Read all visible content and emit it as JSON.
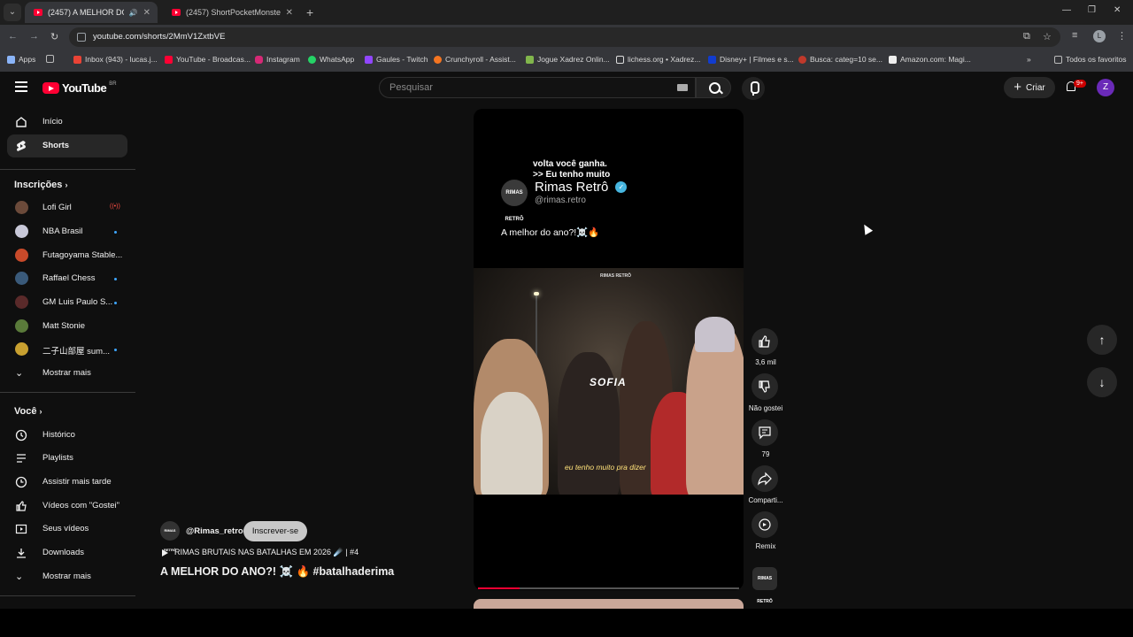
{
  "browser": {
    "tabs": [
      {
        "title": "(2457) A MELHOR DO ANO"
      },
      {
        "title": "(2457) ShortPocketMonster - Yo"
      }
    ],
    "url": "youtube.com/shorts/2MmV1ZxtbVE",
    "bookmarks": [
      "Apps",
      "Inbox (943) - lucas.j...",
      "YouTube - Broadcas...",
      "Instagram",
      "WhatsApp",
      "Gaules - Twitch",
      "Crunchyroll - Assist...",
      "Jogue Xadrez Onlin...",
      "lichess.org • Xadrez...",
      "Disney+ | Filmes e s...",
      "Busca: categ=10 se...",
      "Amazon.com: Magi..."
    ],
    "all_bookmarks": "Todos os favoritos",
    "profile_initial": "L"
  },
  "header": {
    "logo_text": "YouTube",
    "region": "BR",
    "search_placeholder": "Pesquisar",
    "create_label": "Criar",
    "notif_badge": "9+",
    "avatar_initial": "Z"
  },
  "sidebar": {
    "main": [
      {
        "label": "Início",
        "icon": "home-icon"
      },
      {
        "label": "Shorts",
        "icon": "shorts-icon"
      }
    ],
    "subscriptions_title": "Inscrições",
    "subscriptions": [
      {
        "label": "Lofi Girl",
        "live": "((•))",
        "color": "#6b4a3a"
      },
      {
        "label": "NBA Brasil",
        "color": "#c8c8d8"
      },
      {
        "label": "Futagoyama Stable...",
        "color": "#c84a2a"
      },
      {
        "label": "Raffael Chess",
        "color": "#3a5a7a"
      },
      {
        "label": "GM Luis Paulo S...",
        "color": "#5a2a2a"
      },
      {
        "label": "Matt Stonie",
        "color": "#5a7a3a"
      },
      {
        "label": "二子山部屋 sum...",
        "color": "#c8a030"
      }
    ],
    "show_more": "Mostrar mais",
    "you_title": "Você",
    "you": [
      {
        "label": "Histórico",
        "icon": "history-icon"
      },
      {
        "label": "Playlists",
        "icon": "playlists-icon"
      },
      {
        "label": "Assistir mais tarde",
        "icon": "watch-later-icon"
      },
      {
        "label": "Vídeos com \"Gostei\"",
        "icon": "liked-icon"
      },
      {
        "label": "Seus vídeos",
        "icon": "your-videos-icon"
      },
      {
        "label": "Downloads",
        "icon": "download-icon"
      }
    ],
    "show_more_2": "Mostrar mais"
  },
  "short": {
    "top_text_1": "volta você ganha.",
    "top_text_2": ">> Eu tenho muito",
    "channel_display": "Rimas Retrô",
    "channel_handle": "@rimas.retro",
    "caption": "A melhor do ano?!☠️🔥",
    "avatar_text": "RIMAS RETRÔ",
    "photo_logo": "RIMAS RETRÔ",
    "name_overlay": "SOFIA",
    "subtitle": "eu tenho muito pra dizer",
    "progress": 0.16
  },
  "actions": {
    "likes": "3,6 mil",
    "dislike": "Não gostei",
    "comments": "79",
    "share": "Comparti...",
    "remix": "Remix"
  },
  "meta": {
    "handle": "@Rimas_retro",
    "subscribe": "Inscrever-se",
    "playlist": "RIMAS BRUTAIS NAS BATALHAS EM 2026 ☄️ | #4",
    "title": "A MELHOR DO ANO?! ☠️ 🔥 #batalhaderima"
  }
}
